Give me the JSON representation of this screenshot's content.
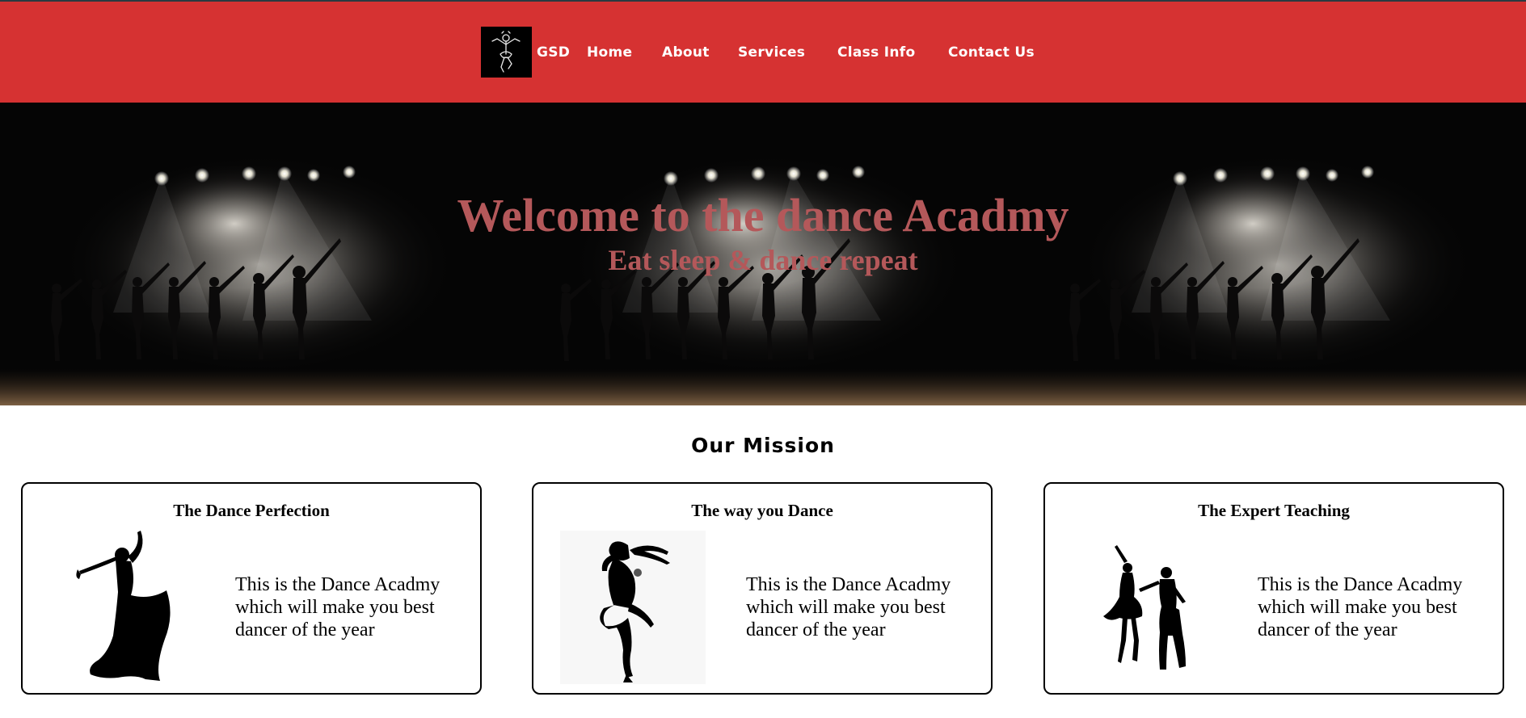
{
  "navbar": {
    "brand": "GSD",
    "links": [
      "Home",
      "About",
      "Services",
      "Class Info",
      "Contact Us"
    ],
    "background_color": "#d63232",
    "logo_icon": "dancer-sketch-icon"
  },
  "hero": {
    "title": "Welcome to the dance Acadmy",
    "subtitle": "Eat sleep & dance repeat",
    "text_color": "#b4585a",
    "image": "stage-spotlights-dancers-image"
  },
  "mission": {
    "heading": "Our Mission",
    "cards": [
      {
        "title": "The Dance Perfection",
        "text": "This is the Dance Acadmy which will make you best dancer of the year",
        "image": "flamenco-dancer-silhouette"
      },
      {
        "title": "The way you Dance",
        "text": "This is the Dance Acadmy which will make you best dancer of the year",
        "image": "jumping-dancer-silhouette"
      },
      {
        "title": "The Expert Teaching",
        "text": "This is the Dance Acadmy which will make you best dancer of the year",
        "image": "latin-couple-silhouette"
      }
    ]
  }
}
